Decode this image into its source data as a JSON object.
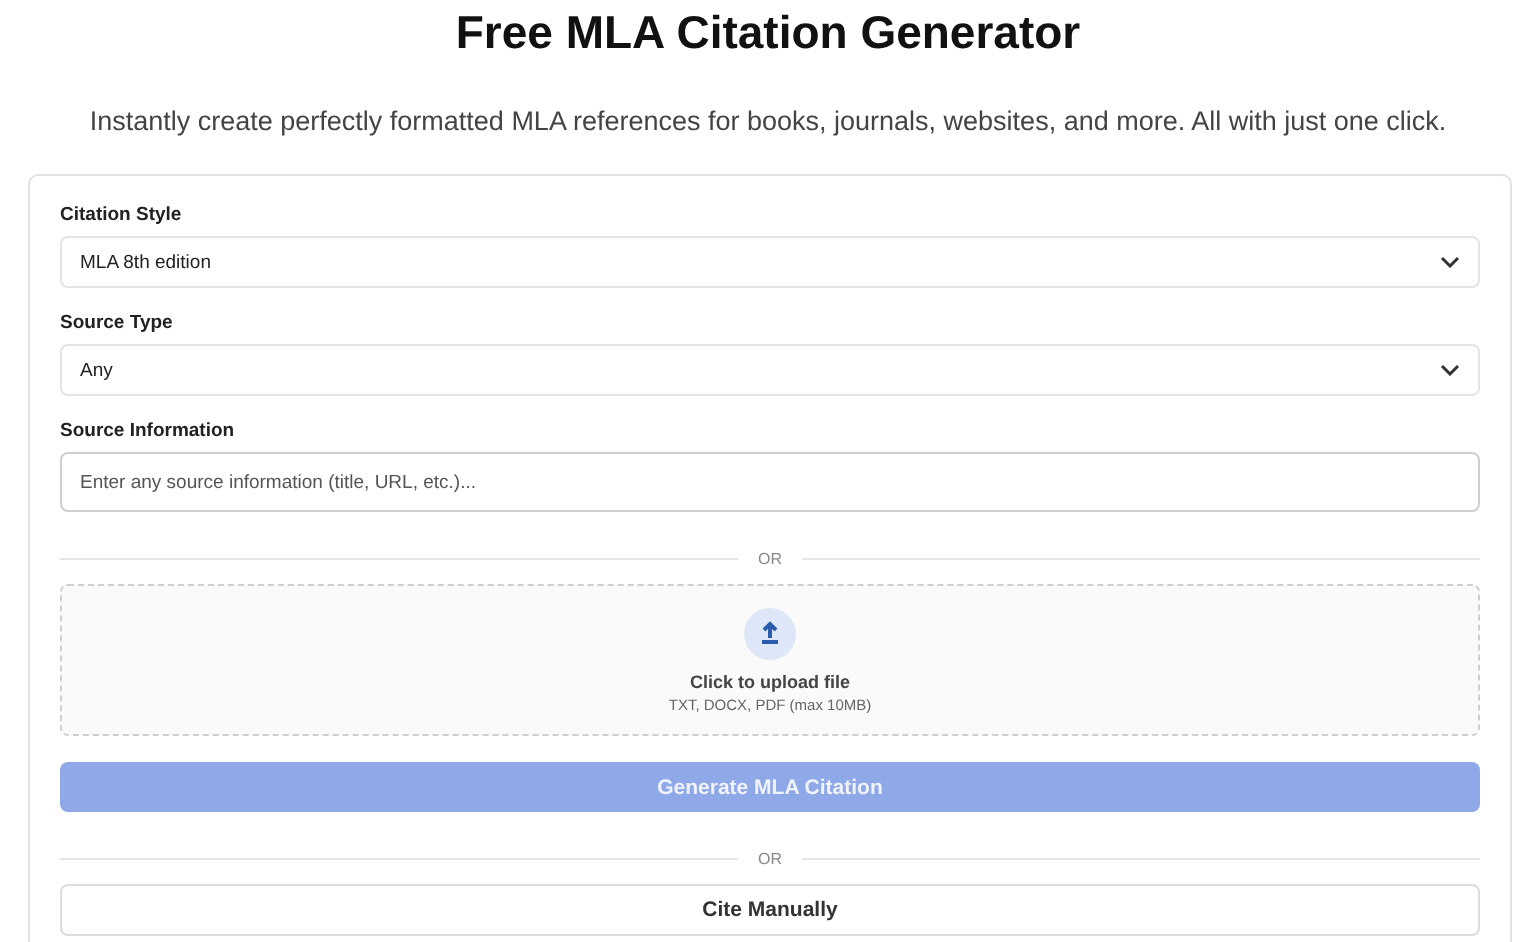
{
  "title": "Free MLA Citation Generator",
  "subtitle": "Instantly create perfectly formatted MLA references for books, journals, websites, and more. All with just one click.",
  "form": {
    "citation_style": {
      "label": "Citation Style",
      "value": "MLA 8th edition"
    },
    "source_type": {
      "label": "Source Type",
      "value": "Any"
    },
    "source_information": {
      "label": "Source Information",
      "placeholder": "Enter any source information (title, URL, etc.)..."
    },
    "divider_1": "OR",
    "upload": {
      "title": "Click to upload file",
      "hint": "TXT, DOCX, PDF (max 10MB)"
    },
    "generate_button": {
      "label": "Generate MLA Citation",
      "disabled": true
    },
    "divider_2": "OR",
    "manual_button": {
      "label": "Cite Manually"
    }
  }
}
